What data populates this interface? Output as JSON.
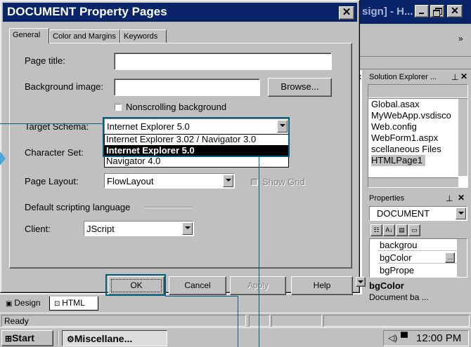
{
  "background_app": {
    "title_fragment": "sign] - H...",
    "ready_status": "Ready",
    "view_tabs": [
      "Design",
      "HTML"
    ],
    "solution_explorer": {
      "title": "Solution Explorer ...",
      "files": [
        "Global.asax",
        "MyWebApp.vsdisco",
        "Web.config",
        "WebForm1.aspx",
        "scellaneous Files",
        "HTMLPage1"
      ]
    },
    "properties": {
      "title": "Properties",
      "object": "DOCUMENT",
      "rows": [
        "backgrou",
        "bgColor",
        "bgPrope"
      ],
      "desc_title": "bgColor",
      "desc_text": "Document ba ..."
    }
  },
  "dialog": {
    "title": "DOCUMENT Property Pages",
    "tabs": [
      "General",
      "Color and Margins",
      "Keywords"
    ],
    "page_title_label": "Page title:",
    "page_title_value": "",
    "background_image_label": "Background image:",
    "background_image_value": "",
    "browse_label": "Browse...",
    "nonscrolling_label": "Nonscrolling background",
    "target_schema_label": "Target Schema:",
    "target_schema_value": "Internet Explorer 5.0",
    "target_schema_options": [
      "Internet Explorer 3.02 / Navigator 3.0",
      "Internet Explorer 5.0",
      "Navigator 4.0"
    ],
    "character_set_label": "Character Set:",
    "page_layout_label": "Page Layout:",
    "page_layout_value": "FlowLayout",
    "show_grid_label": "Show Grid",
    "scripting_label": "Default scripting language",
    "client_label": "Client:",
    "client_value": "JScript",
    "buttons": {
      "ok": "OK",
      "cancel": "Cancel",
      "apply": "Apply",
      "help": "Help"
    }
  },
  "taskbar": {
    "start_label": "Start",
    "task_label": "Miscellane...",
    "clock": "12:00 PM"
  },
  "colors": {
    "titlebar": "#0a246a",
    "selection": "#000000",
    "callout": "#006080",
    "desktop": "#c0c0c0"
  }
}
